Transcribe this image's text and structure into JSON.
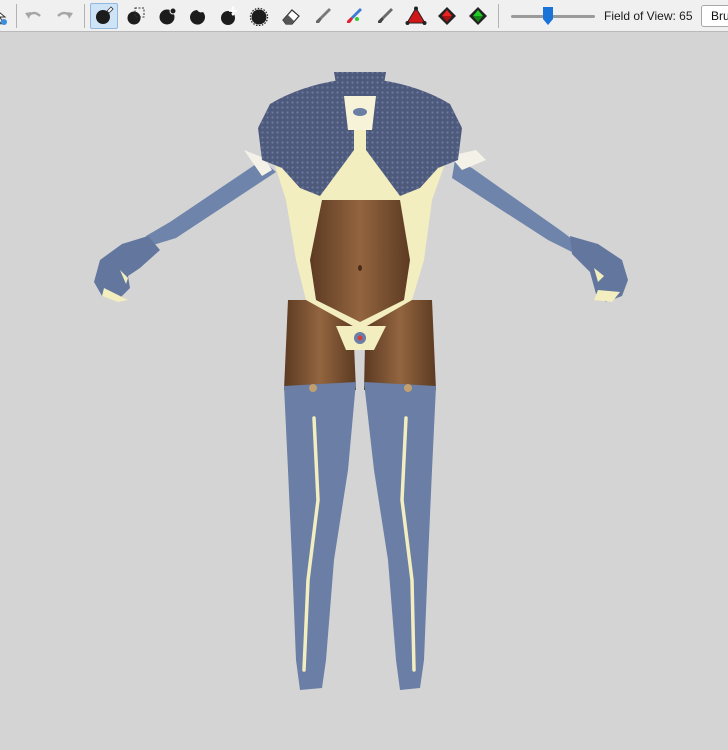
{
  "toolbar": {
    "fov_label": "Field of View: 65",
    "brush_box_label": "Bru",
    "tools": [
      "cursor-icon",
      "undo-icon",
      "redo-icon",
      "sculpt-brush-icon",
      "selection-box-icon",
      "inflate-brush-icon",
      "deflate-brush-icon",
      "move-brush-icon",
      "smooth-brush-icon",
      "eraser-icon",
      "brush-gray-icon",
      "color-brush-icon",
      "paint-brush-icon",
      "vertex-red-icon",
      "arrow-red-icon",
      "arrow-green-icon"
    ],
    "active_tool": "sculpt-brush-icon",
    "fov_value": 65
  },
  "viewport": {
    "background": "#d4d4d4",
    "model_colors": {
      "suit": "#6c7fa3",
      "mesh": "#4a5778",
      "trim": "#f3eec0",
      "skin": "#8a5d3e"
    }
  }
}
